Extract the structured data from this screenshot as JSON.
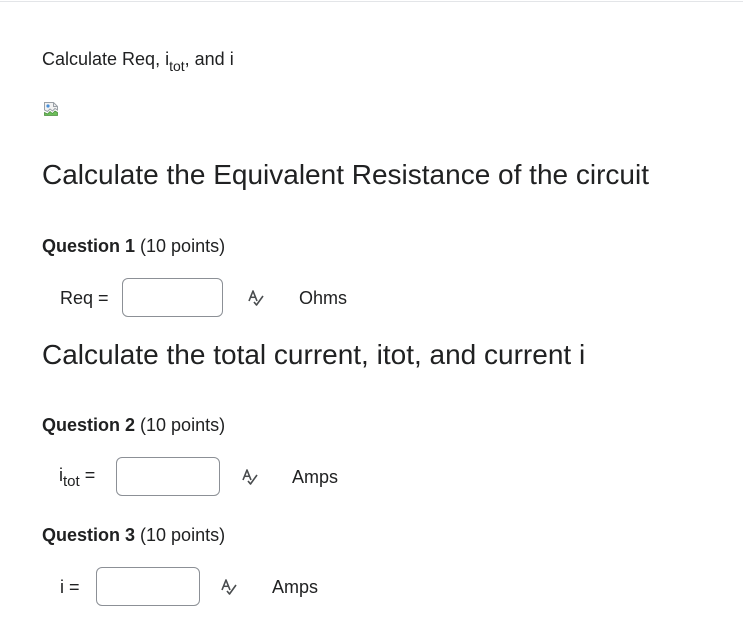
{
  "intro": {
    "prefix": "Calculate Req, i",
    "sub": "tot",
    "suffix": ", and i"
  },
  "sections": [
    {
      "heading": "Calculate the Equivalent Resistance of the circuit"
    },
    {
      "heading": "Calculate the total current, itot, and current i"
    }
  ],
  "questions": [
    {
      "title": "Question 1",
      "points": "(10 points)",
      "var_main": "Req",
      "var_sub": "",
      "equals": "=",
      "value": "",
      "unit": "Ohms",
      "check_icon": "spell-check-icon"
    },
    {
      "title": "Question 2",
      "points": "(10 points)",
      "var_main": "i",
      "var_sub": "tot",
      "equals": "=",
      "value": "",
      "unit": "Amps",
      "check_icon": "spell-check-icon"
    },
    {
      "title": "Question 3",
      "points": "(10 points)",
      "var_main": "i",
      "var_sub": "",
      "equals": "=",
      "value": "",
      "unit": "Amps",
      "check_icon": "spell-check-icon"
    }
  ],
  "image": {
    "icon": "broken-image-icon"
  },
  "colors": {
    "text": "#202122",
    "input_border": "#8c9096",
    "icon_stroke": "#494c4e"
  }
}
